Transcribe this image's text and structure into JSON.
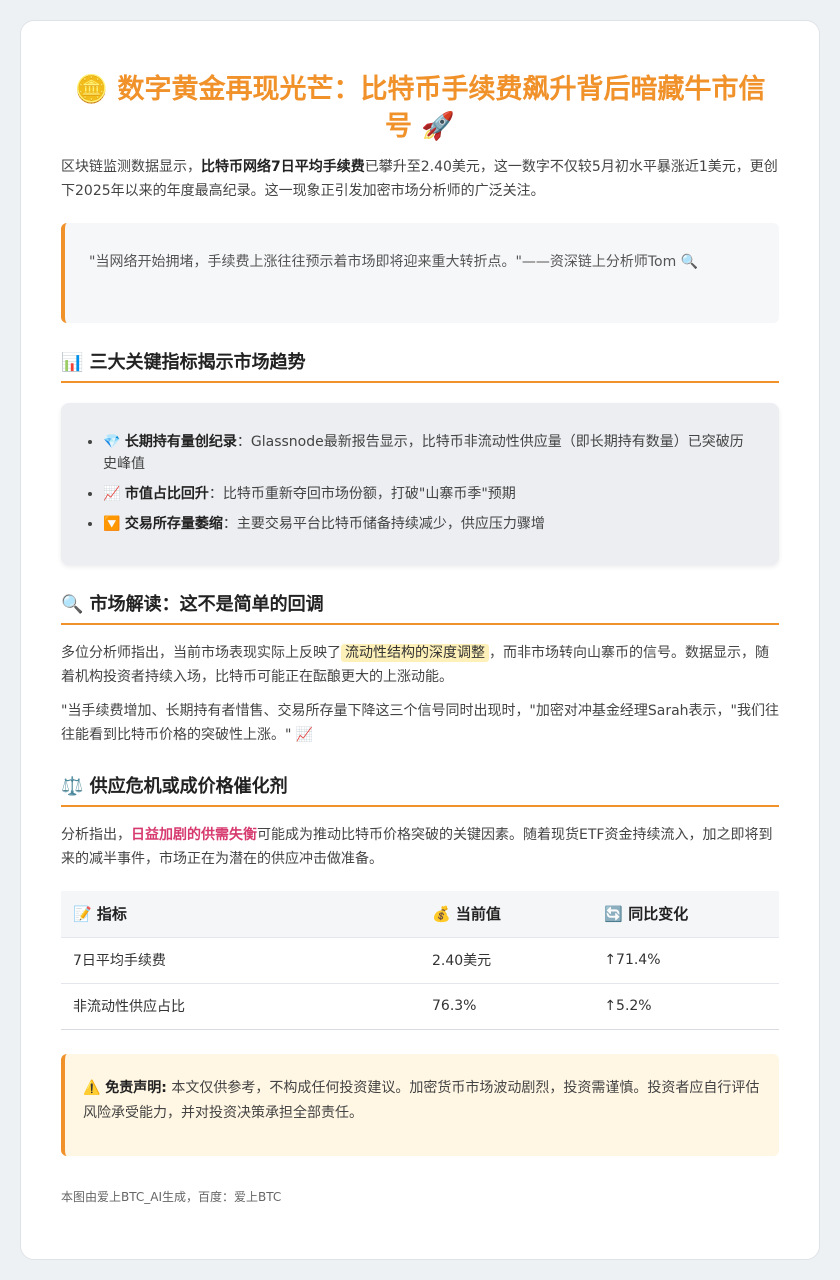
{
  "title": "🪙 数字黄金再现光芒：比特币手续费飙升背后暗藏牛市信号 🚀",
  "intro": {
    "prefix": "区块链监测数据显示，",
    "bold": "比特币网络7日平均手续费",
    "suffix": "已攀升至2.40美元，这一数字不仅较5月初水平暴涨近1美元，更创下2025年以来的年度最高纪录。这一现象正引发加密市场分析师的广泛关注。"
  },
  "quote": "\"当网络开始拥堵，手续费上涨往往预示着市场即将迎来重大转折点。\"——资深链上分析师Tom 🔍",
  "section1": {
    "title": "📊 三大关键指标揭示市场趋势",
    "items": [
      {
        "icon": "💎",
        "label": "长期持有量创纪录",
        "text": "：Glassnode最新报告显示，比特币非流动性供应量（即长期持有数量）已突破历史峰值"
      },
      {
        "icon": "📈",
        "label": "市值占比回升",
        "text": "：比特币重新夺回市场份额，打破\"山寨币季\"预期"
      },
      {
        "icon": "🔽",
        "label": "交易所存量萎缩",
        "text": "：主要交易平台比特币储备持续减少，供应压力骤增"
      }
    ]
  },
  "section2": {
    "title": "🔍 市场解读：这不是简单的回调",
    "p1_prefix": "多位分析师指出，当前市场表现实际上反映了",
    "p1_highlight": "流动性结构的深度调整",
    "p1_suffix": "，而非市场转向山寨币的信号。数据显示，随着机构投资者持续入场，比特币可能正在酝酿更大的上涨动能。",
    "p2": "\"当手续费增加、长期持有者惜售、交易所存量下降这三个信号同时出现时，\"加密对冲基金经理Sarah表示，\"我们往往能看到比特币价格的突破性上涨。\" 📈"
  },
  "section3": {
    "title": "⚖️ 供应危机或成价格催化剂",
    "p_prefix": "分析指出，",
    "p_highlight": "日益加剧的供需失衡",
    "p_suffix": "可能成为推动比特币价格突破的关键因素。随着现货ETF资金持续流入，加之即将到来的减半事件，市场正在为潜在的供应冲击做准备。"
  },
  "table": {
    "headers": [
      "📝 指标",
      "💰 当前值",
      "🔄 同比变化"
    ],
    "rows": [
      {
        "metric": "7日平均手续费",
        "value": "2.40美元",
        "change": "↑71.4%"
      },
      {
        "metric": "非流动性供应占比",
        "value": "76.3%",
        "change": "↑5.2%"
      }
    ]
  },
  "disclaimer": {
    "label": "⚠️ 免责声明:",
    "text": " 本文仅供参考，不构成任何投资建议。加密货币市场波动剧烈，投资需谨慎。投资者应自行评估风险承受能力，并对投资决策承担全部责任。"
  },
  "footer": "本图由爱上BTC_AI生成，百度：爱上BTC",
  "colors": {
    "accent": "#f0912a",
    "highlight_bg": "#fdf0b8",
    "pink": "#d63a6f",
    "up_green": "#2e9e4f",
    "disclaimer_bg": "#fff6e3"
  }
}
